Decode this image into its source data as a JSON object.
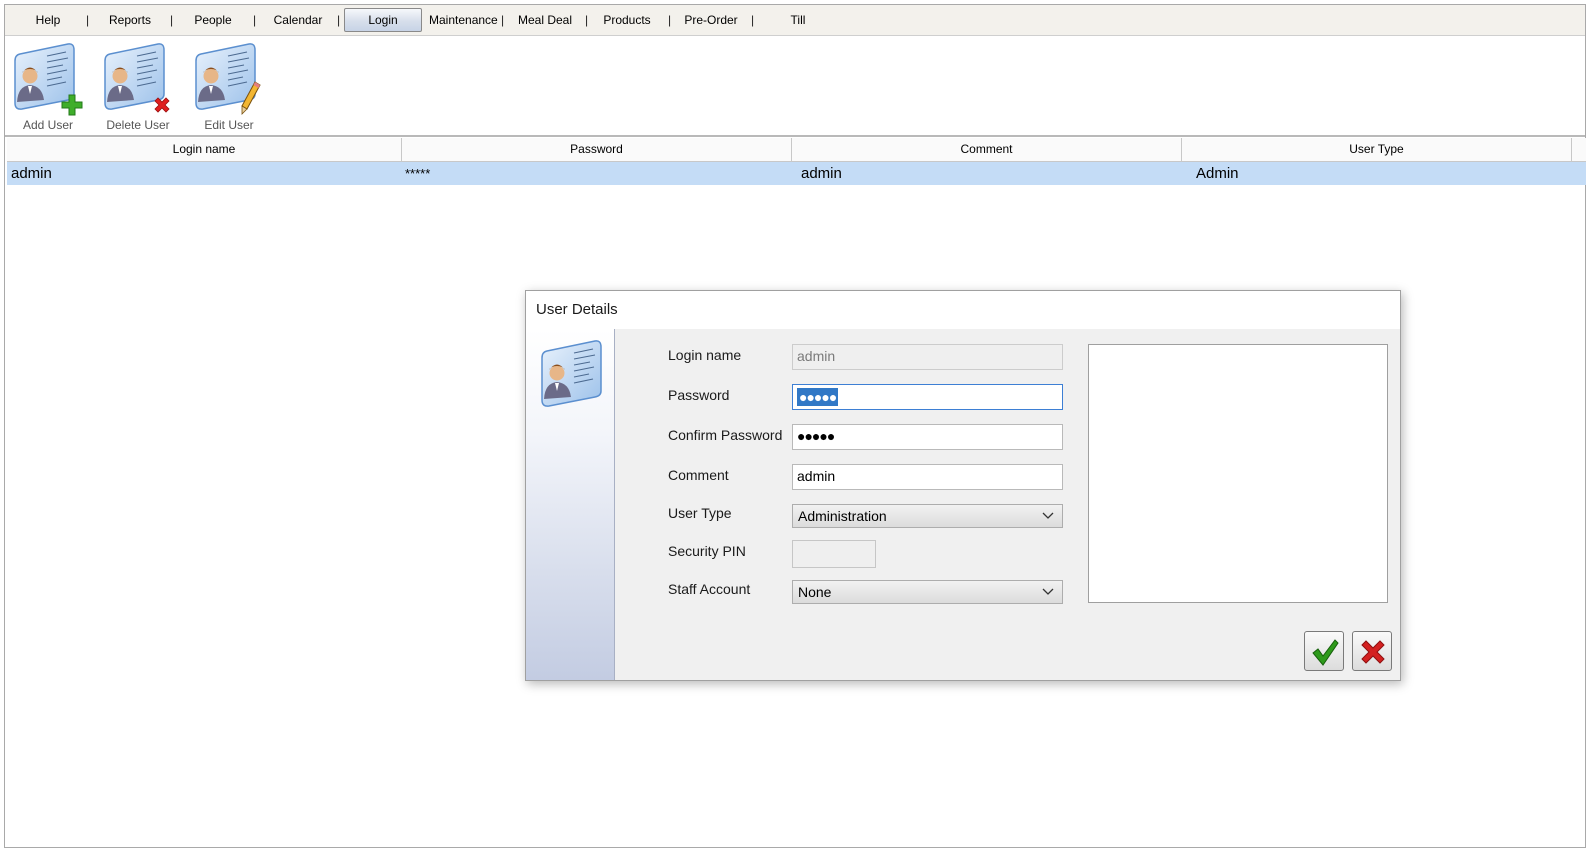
{
  "menu": {
    "items": [
      "Help",
      "Reports",
      "People",
      "Calendar",
      "Login",
      "Maintenance",
      "Meal Deal",
      "Products",
      "Pre-Order",
      "Till"
    ],
    "separator": "|",
    "active": "Login"
  },
  "toolbar": {
    "add_label": "Add User",
    "delete_label": "Delete User",
    "edit_label": "Edit User"
  },
  "grid": {
    "columns": [
      "Login name",
      "Password",
      "Comment",
      "User Type"
    ],
    "rows": [
      [
        "admin",
        "*****",
        "admin",
        "Admin"
      ]
    ]
  },
  "dialog": {
    "title": "User Details",
    "labels": {
      "login_name": "Login name",
      "password": "Password",
      "confirm_password": "Confirm Password",
      "comment": "Comment",
      "user_type": "User Type",
      "security_pin": "Security PIN",
      "staff_account": "Staff Account"
    },
    "values": {
      "login_name": "admin",
      "password": "●●●●●",
      "confirm_password": "●●●●●",
      "comment": "admin",
      "user_type": "Administration",
      "security_pin": "",
      "staff_account": "None"
    },
    "icons": {
      "ok": "green-check-icon",
      "cancel": "red-x-icon"
    }
  },
  "colors": {
    "selected_row": "#c4dcf6",
    "menubar": "#f3f1ec",
    "focus_border": "#3d7fd4",
    "ok_green": "#2e9a1b",
    "cancel_red": "#d42020"
  }
}
